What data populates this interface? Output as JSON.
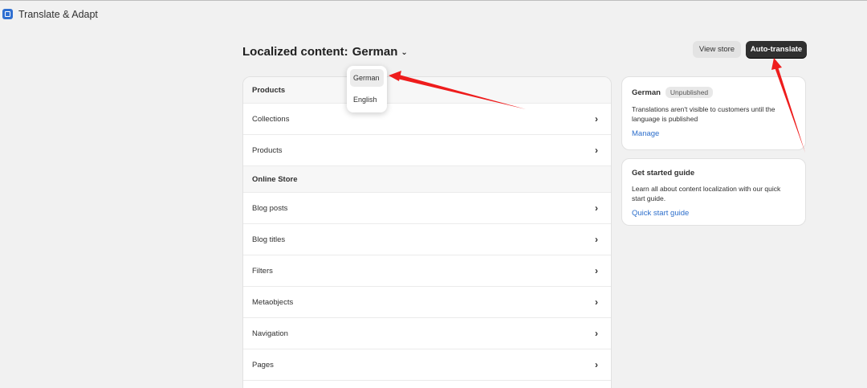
{
  "app": {
    "title": "Translate & Adapt"
  },
  "heading": {
    "prefix": "Localized content:",
    "language": "German"
  },
  "actions": {
    "view_store": "View store",
    "auto_translate": "Auto-translate"
  },
  "language_menu": {
    "options": [
      "German",
      "English"
    ],
    "selected": "German"
  },
  "content_list": {
    "rows": [
      {
        "label": "Products",
        "section": true
      },
      {
        "label": "Collections",
        "section": false
      },
      {
        "label": "Products",
        "section": false
      },
      {
        "label": "Online Store",
        "section": true
      },
      {
        "label": "Blog posts",
        "section": false
      },
      {
        "label": "Blog titles",
        "section": false
      },
      {
        "label": "Filters",
        "section": false
      },
      {
        "label": "Metaobjects",
        "section": false
      },
      {
        "label": "Navigation",
        "section": false
      },
      {
        "label": "Pages",
        "section": false
      }
    ]
  },
  "status_card": {
    "language": "German",
    "badge": "Unpublished",
    "text": "Translations aren't visible to customers until the language is published",
    "link": "Manage"
  },
  "guide_card": {
    "title": "Get started guide",
    "text": "Learn all about content localization with our quick start guide.",
    "link": "Quick start guide"
  },
  "colors": {
    "annotation_arrow": "#ee1c1c",
    "primary_button": "#303030",
    "link": "#2c6ecb"
  }
}
